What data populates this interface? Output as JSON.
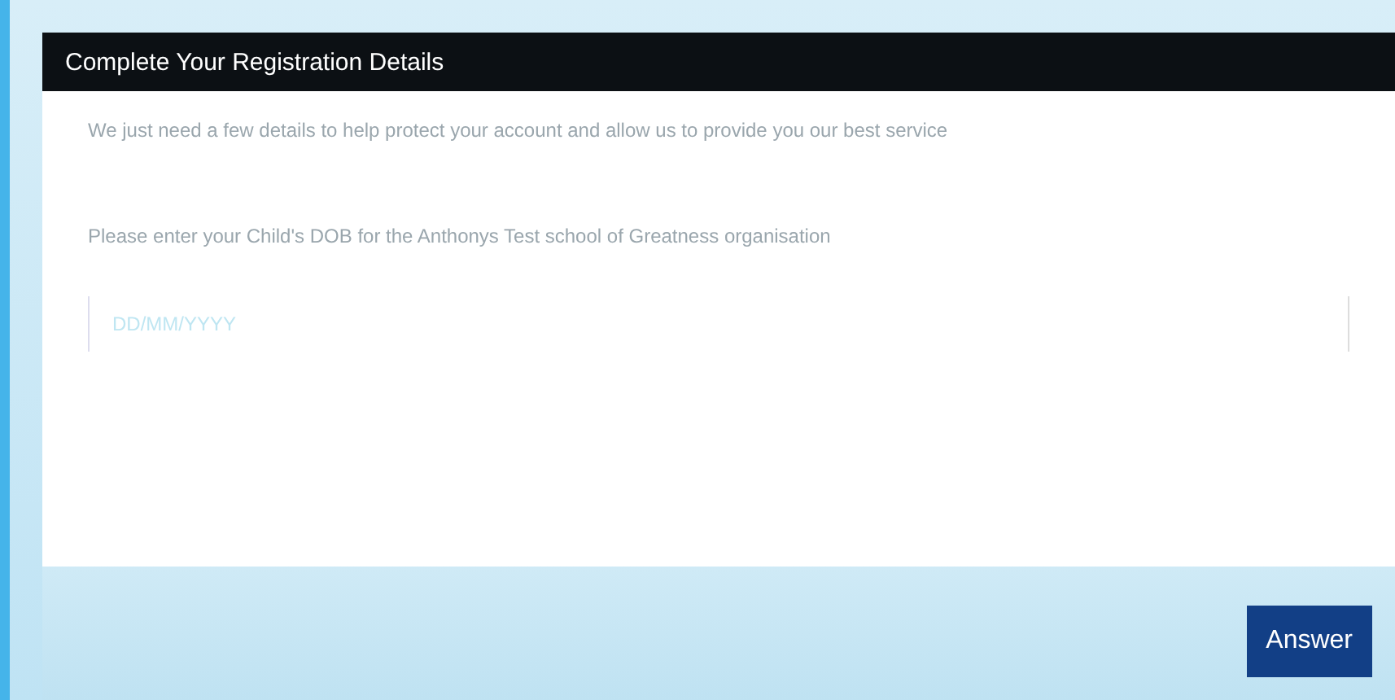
{
  "dialog": {
    "title": "Complete Your Registration Details",
    "intro": "We just need a few details to help protect your account and allow us to provide you our best service",
    "question": "Please enter your Child's DOB for the Anthonys Test school of Greatness organisation",
    "answer_field": {
      "placeholder": "DD/MM/YYYY"
    },
    "buttons": [
      "Answer"
    ]
  }
}
